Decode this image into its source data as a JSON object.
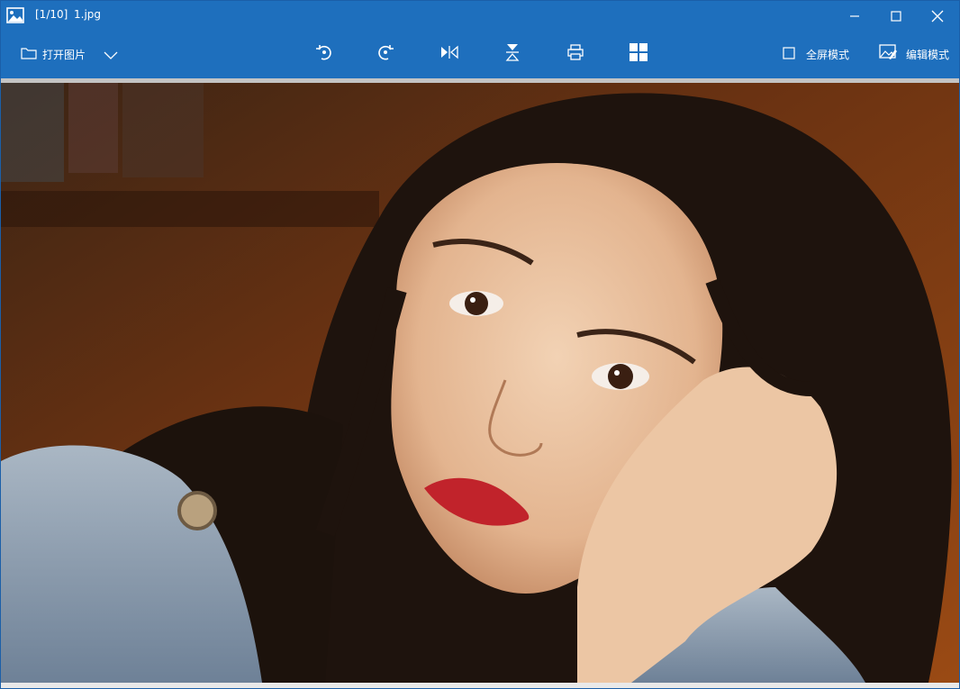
{
  "window": {
    "title_index": "[1/10]",
    "title_file": "1.jpg"
  },
  "window_controls": {
    "minimize_icon": "minimize-icon",
    "maximize_icon": "maximize-icon",
    "close_icon": "close-icon"
  },
  "toolbar": {
    "open_label": "打开图片",
    "fullscreen_label": "全屏模式",
    "edit_label": "编辑模式",
    "icons": [
      "folder-icon",
      "chevron-down-icon",
      "rotate-left-icon",
      "rotate-right-icon",
      "flip-horizontal-icon",
      "flip-vertical-icon",
      "print-icon",
      "grid-icon",
      "checkbox-icon",
      "edit-image-icon"
    ]
  },
  "colors": {
    "titlebar": "#1e6fbd",
    "divider": "#c4c4c4"
  }
}
